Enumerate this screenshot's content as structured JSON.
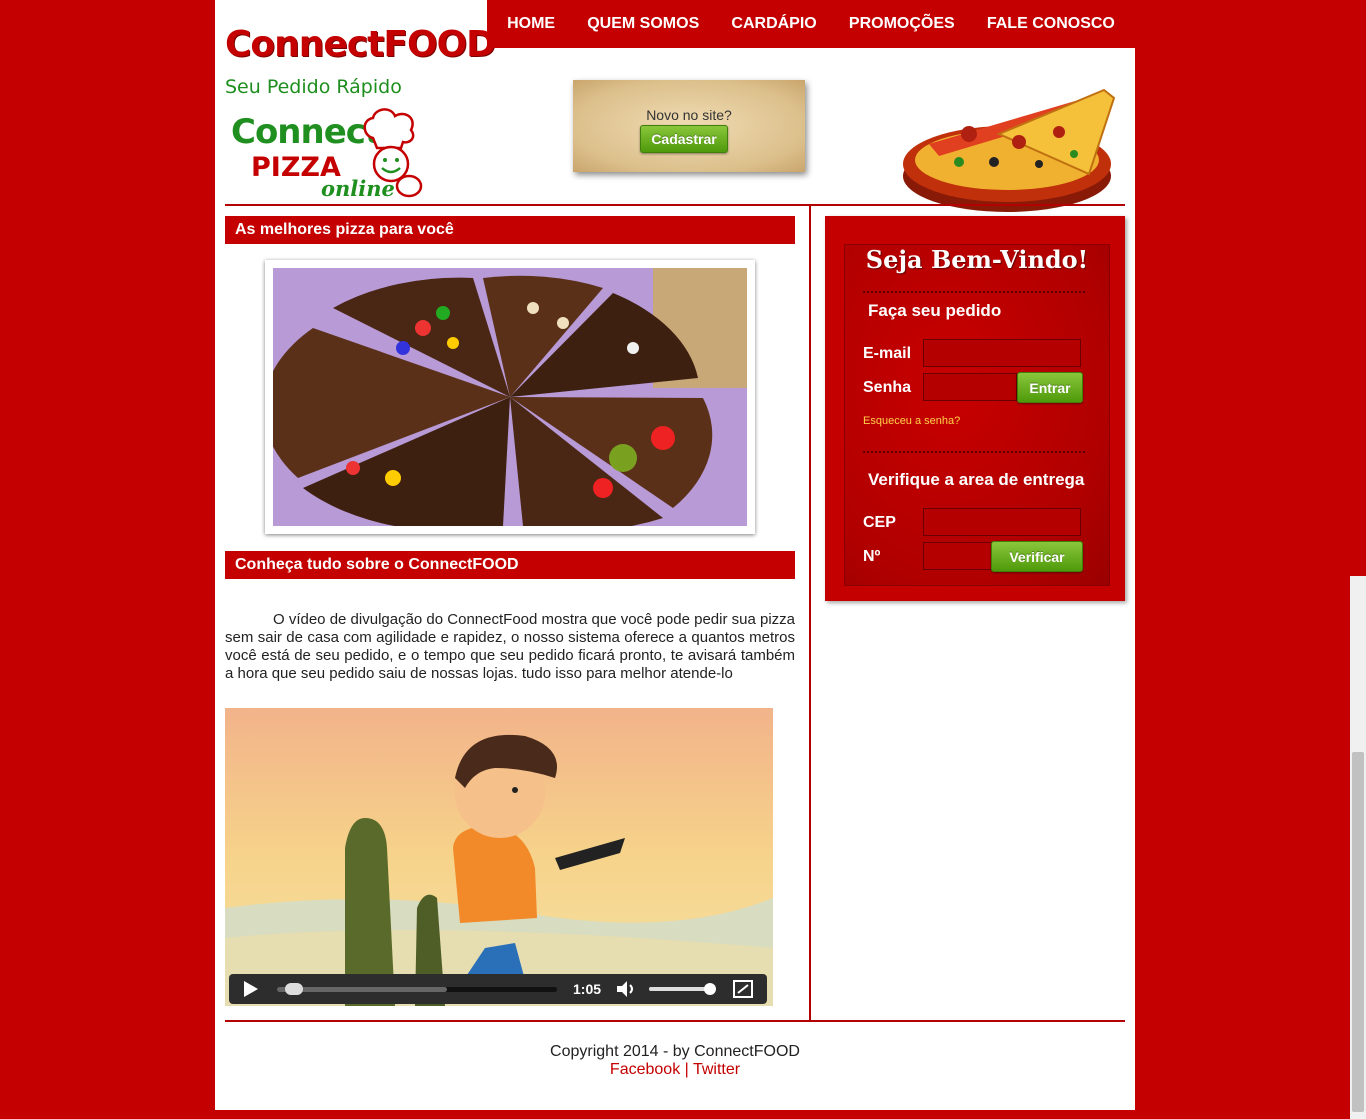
{
  "header": {
    "logo_title": "ConnectFOOD",
    "logo_subtitle": "Seu Pedido Rápido",
    "pizza_logo": {
      "connect": "Connect",
      "pizza": "PIZZA",
      "online": "online"
    },
    "nav": [
      "HOME",
      "QUEM SOMOS",
      "CARDÁPIO",
      "PROMOÇÕES",
      "FALE CONOSCO"
    ],
    "signup": {
      "text": "Novo no site?",
      "button": "Cadastrar"
    }
  },
  "main": {
    "section1_title": "As melhores pizza para você",
    "section2_title": "Conheça tudo sobre o ConnectFOOD",
    "description": "O vídeo de divulgação do ConnectFood mostra que você pode pedir sua pizza sem sair de casa com agilidade e rapidez, o nosso sistema oferece a quantos metros você está de seu pedido, e o tempo que seu pedido ficará pronto, te avisará também a hora que seu pedido saiu de nossas lojas. tudo isso para melhor atende-lo",
    "video": {
      "time": "1:05",
      "progress": 0.03,
      "volume": 0.95
    }
  },
  "sidebar": {
    "welcome": "Seja Bem-Vindo!",
    "order_title": "Faça seu pedido",
    "email_label": "E-mail",
    "password_label": "Senha",
    "login_button": "Entrar",
    "forgot": "Esqueceu a senha?",
    "delivery_title": "Verifique a area de entrega",
    "cep_label": "CEP",
    "number_label": "Nº",
    "verify_button": "Verificar"
  },
  "footer": {
    "copyright": "Copyright 2014 - by ConnectFOOD",
    "facebook": "Facebook",
    "separator": "|",
    "twitter": "Twitter"
  },
  "colors": {
    "brand": "#c40000",
    "green": "#4e9a0b",
    "link": "#c40000"
  }
}
